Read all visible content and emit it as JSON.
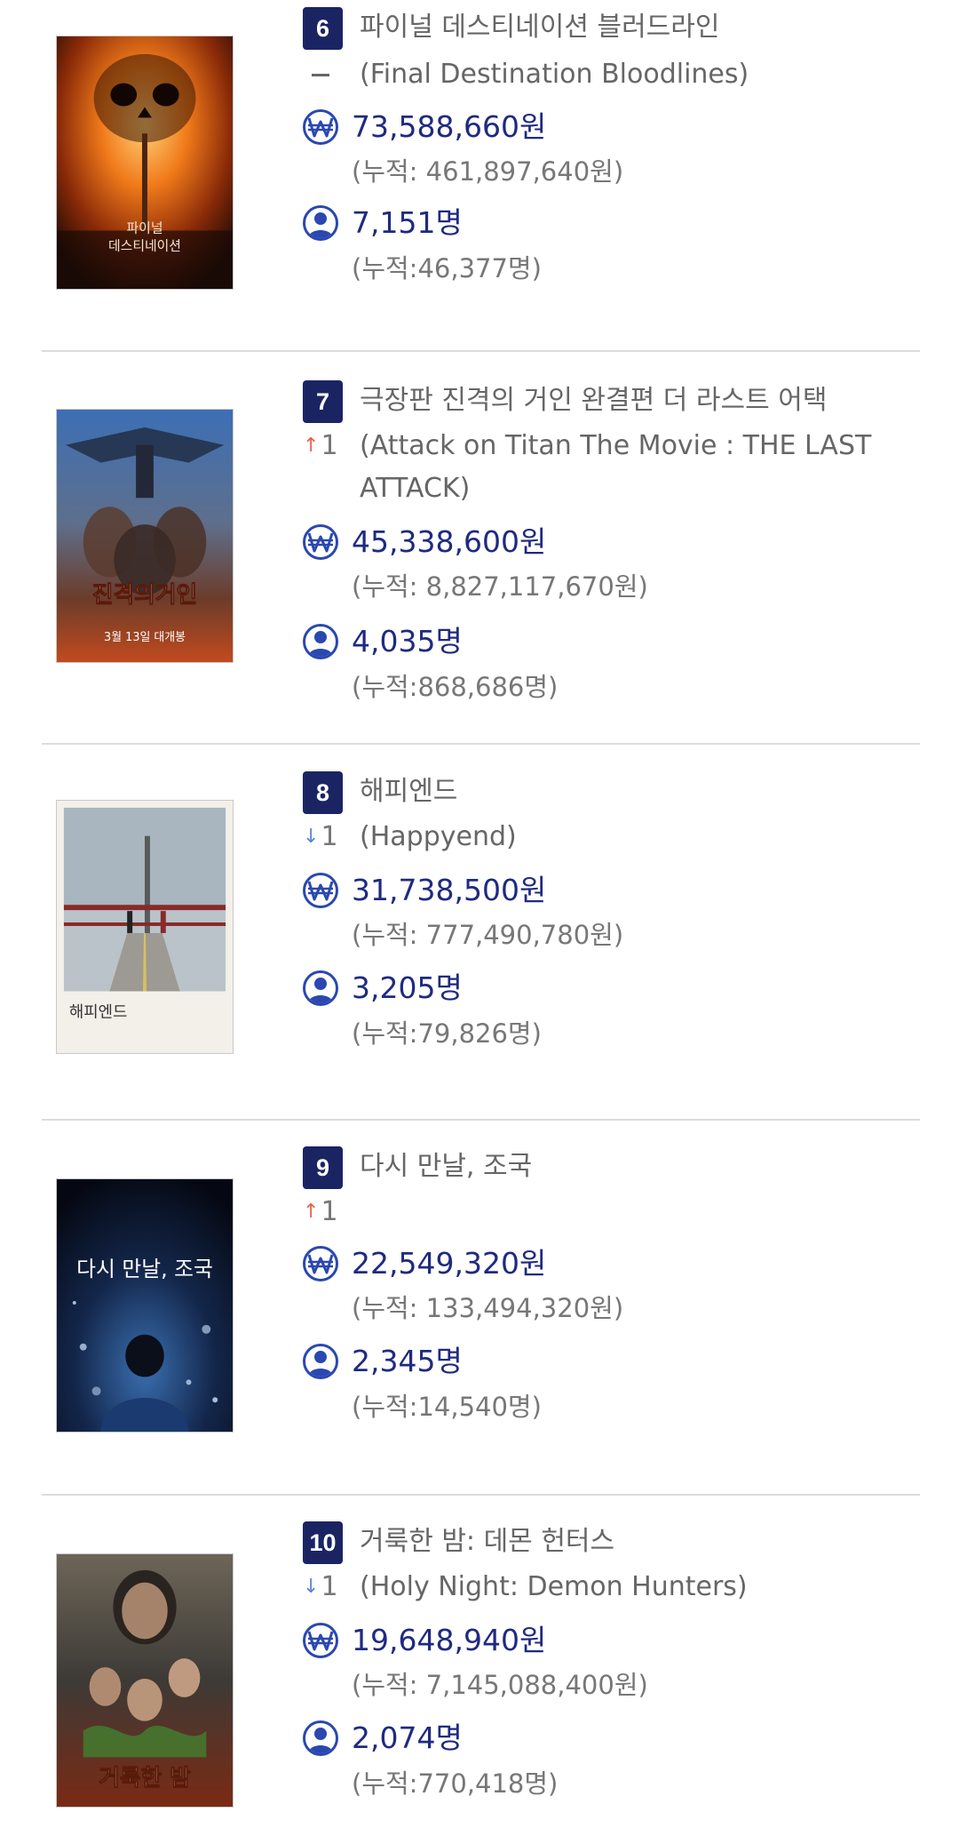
{
  "colors": {
    "badge": "#1b2463",
    "revenue_value": "#1f2a80",
    "icon": "#2a48b0",
    "up_arrow": "#e8624f",
    "down_arrow": "#5a86d8",
    "divider": "#dcdcdc"
  },
  "movies": [
    {
      "rank": "6",
      "title_ko": "파이널 데스티네이션 블러드라인",
      "change_icon": "no-change-dash",
      "change_text": "",
      "title_en": "(Final Destination Bloodlines)",
      "revenue_icon": "won-icon",
      "revenue": "73,588,660원",
      "revenue_cumulative": "(누적: 461,897,640원)",
      "audience_icon": "person-icon",
      "audience": "7,151명",
      "audience_cumulative": "(누적:46,377명)",
      "poster_text": [
        "파이널",
        "데스티네이션"
      ]
    },
    {
      "rank": "7",
      "title_ko": "극장판 진격의 거인 완결편 더 라스트 어택",
      "change_icon": "up-arrow",
      "change_text": "1",
      "title_en": "(Attack on Titan The Movie : THE LAST ATTACK)",
      "revenue_icon": "won-icon",
      "revenue": "45,338,600원",
      "revenue_cumulative": "(누적: 8,827,117,670원)",
      "audience_icon": "person-icon",
      "audience": "4,035명",
      "audience_cumulative": "(누적:868,686명)",
      "poster_text": [
        "진격의거인",
        "3월 13일 대개봉"
      ]
    },
    {
      "rank": "8",
      "title_ko": "해피엔드",
      "change_icon": "down-arrow",
      "change_text": "1",
      "title_en": "(Happyend)",
      "revenue_icon": "won-icon",
      "revenue": "31,738,500원",
      "revenue_cumulative": "(누적: 777,490,780원)",
      "audience_icon": "person-icon",
      "audience": "3,205명",
      "audience_cumulative": "(누적:79,826명)",
      "poster_text": [
        "해피엔드"
      ]
    },
    {
      "rank": "9",
      "title_ko": "다시 만날, 조국",
      "change_icon": "up-arrow",
      "change_text": "1",
      "title_en": "",
      "revenue_icon": "won-icon",
      "revenue": "22,549,320원",
      "revenue_cumulative": "(누적: 133,494,320원)",
      "audience_icon": "person-icon",
      "audience": "2,345명",
      "audience_cumulative": "(누적:14,540명)",
      "poster_text": [
        "다시 만날, 조국"
      ]
    },
    {
      "rank": "10",
      "title_ko": "거룩한 밤: 데몬 헌터스",
      "change_icon": "down-arrow",
      "change_text": "1",
      "title_en": "(Holy Night: Demon Hunters)",
      "revenue_icon": "won-icon",
      "revenue": "19,648,940원",
      "revenue_cumulative": "(누적: 7,145,088,400원)",
      "audience_icon": "person-icon",
      "audience": "2,074명",
      "audience_cumulative": "(누적:770,418명)",
      "poster_text": [
        "거룩한 밤"
      ]
    }
  ]
}
